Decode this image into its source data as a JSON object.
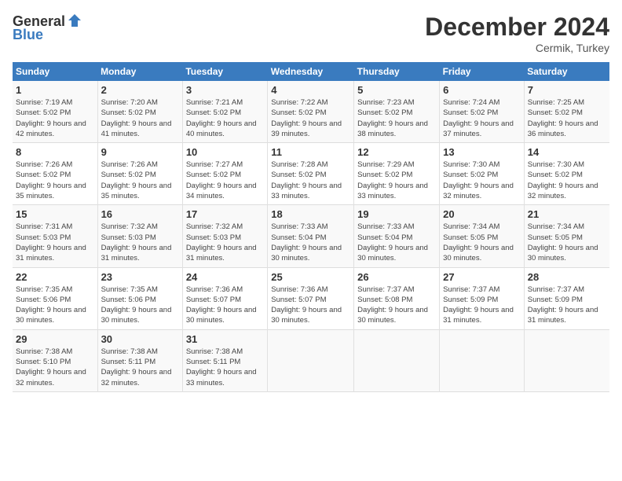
{
  "logo": {
    "general": "General",
    "blue": "Blue"
  },
  "title": "December 2024",
  "location": "Cermik, Turkey",
  "days_of_week": [
    "Sunday",
    "Monday",
    "Tuesday",
    "Wednesday",
    "Thursday",
    "Friday",
    "Saturday"
  ],
  "weeks": [
    [
      {
        "day": "1",
        "sunrise": "7:19 AM",
        "sunset": "5:02 PM",
        "daylight": "9 hours and 42 minutes."
      },
      {
        "day": "2",
        "sunrise": "7:20 AM",
        "sunset": "5:02 PM",
        "daylight": "9 hours and 41 minutes."
      },
      {
        "day": "3",
        "sunrise": "7:21 AM",
        "sunset": "5:02 PM",
        "daylight": "9 hours and 40 minutes."
      },
      {
        "day": "4",
        "sunrise": "7:22 AM",
        "sunset": "5:02 PM",
        "daylight": "9 hours and 39 minutes."
      },
      {
        "day": "5",
        "sunrise": "7:23 AM",
        "sunset": "5:02 PM",
        "daylight": "9 hours and 38 minutes."
      },
      {
        "day": "6",
        "sunrise": "7:24 AM",
        "sunset": "5:02 PM",
        "daylight": "9 hours and 37 minutes."
      },
      {
        "day": "7",
        "sunrise": "7:25 AM",
        "sunset": "5:02 PM",
        "daylight": "9 hours and 36 minutes."
      }
    ],
    [
      {
        "day": "8",
        "sunrise": "7:26 AM",
        "sunset": "5:02 PM",
        "daylight": "9 hours and 35 minutes."
      },
      {
        "day": "9",
        "sunrise": "7:26 AM",
        "sunset": "5:02 PM",
        "daylight": "9 hours and 35 minutes."
      },
      {
        "day": "10",
        "sunrise": "7:27 AM",
        "sunset": "5:02 PM",
        "daylight": "9 hours and 34 minutes."
      },
      {
        "day": "11",
        "sunrise": "7:28 AM",
        "sunset": "5:02 PM",
        "daylight": "9 hours and 33 minutes."
      },
      {
        "day": "12",
        "sunrise": "7:29 AM",
        "sunset": "5:02 PM",
        "daylight": "9 hours and 33 minutes."
      },
      {
        "day": "13",
        "sunrise": "7:30 AM",
        "sunset": "5:02 PM",
        "daylight": "9 hours and 32 minutes."
      },
      {
        "day": "14",
        "sunrise": "7:30 AM",
        "sunset": "5:02 PM",
        "daylight": "9 hours and 32 minutes."
      }
    ],
    [
      {
        "day": "15",
        "sunrise": "7:31 AM",
        "sunset": "5:03 PM",
        "daylight": "9 hours and 31 minutes."
      },
      {
        "day": "16",
        "sunrise": "7:32 AM",
        "sunset": "5:03 PM",
        "daylight": "9 hours and 31 minutes."
      },
      {
        "day": "17",
        "sunrise": "7:32 AM",
        "sunset": "5:03 PM",
        "daylight": "9 hours and 31 minutes."
      },
      {
        "day": "18",
        "sunrise": "7:33 AM",
        "sunset": "5:04 PM",
        "daylight": "9 hours and 30 minutes."
      },
      {
        "day": "19",
        "sunrise": "7:33 AM",
        "sunset": "5:04 PM",
        "daylight": "9 hours and 30 minutes."
      },
      {
        "day": "20",
        "sunrise": "7:34 AM",
        "sunset": "5:05 PM",
        "daylight": "9 hours and 30 minutes."
      },
      {
        "day": "21",
        "sunrise": "7:34 AM",
        "sunset": "5:05 PM",
        "daylight": "9 hours and 30 minutes."
      }
    ],
    [
      {
        "day": "22",
        "sunrise": "7:35 AM",
        "sunset": "5:06 PM",
        "daylight": "9 hours and 30 minutes."
      },
      {
        "day": "23",
        "sunrise": "7:35 AM",
        "sunset": "5:06 PM",
        "daylight": "9 hours and 30 minutes."
      },
      {
        "day": "24",
        "sunrise": "7:36 AM",
        "sunset": "5:07 PM",
        "daylight": "9 hours and 30 minutes."
      },
      {
        "day": "25",
        "sunrise": "7:36 AM",
        "sunset": "5:07 PM",
        "daylight": "9 hours and 30 minutes."
      },
      {
        "day": "26",
        "sunrise": "7:37 AM",
        "sunset": "5:08 PM",
        "daylight": "9 hours and 30 minutes."
      },
      {
        "day": "27",
        "sunrise": "7:37 AM",
        "sunset": "5:09 PM",
        "daylight": "9 hours and 31 minutes."
      },
      {
        "day": "28",
        "sunrise": "7:37 AM",
        "sunset": "5:09 PM",
        "daylight": "9 hours and 31 minutes."
      }
    ],
    [
      {
        "day": "29",
        "sunrise": "7:38 AM",
        "sunset": "5:10 PM",
        "daylight": "9 hours and 32 minutes."
      },
      {
        "day": "30",
        "sunrise": "7:38 AM",
        "sunset": "5:11 PM",
        "daylight": "9 hours and 32 minutes."
      },
      {
        "day": "31",
        "sunrise": "7:38 AM",
        "sunset": "5:11 PM",
        "daylight": "9 hours and 33 minutes."
      },
      null,
      null,
      null,
      null
    ]
  ]
}
